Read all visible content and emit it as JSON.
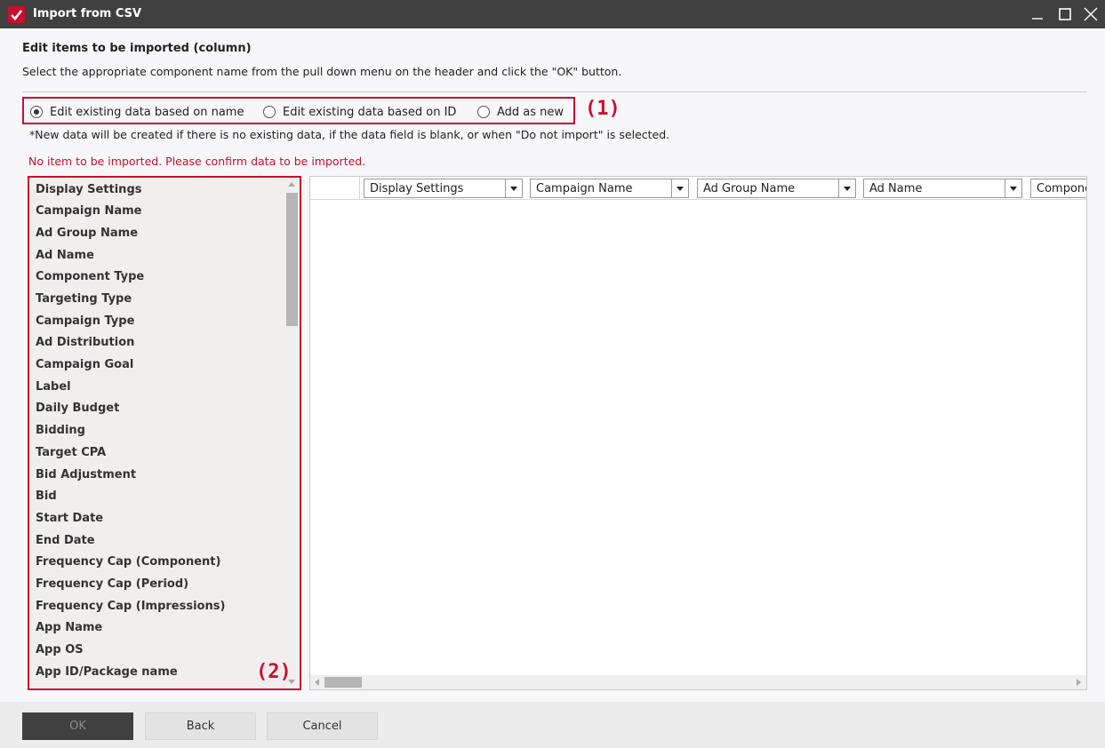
{
  "window": {
    "title": "Import from CSV"
  },
  "header": {
    "section_title": "Edit items to be imported (column)",
    "instruction": "Select the appropriate component name from the pull down menu on the header and click the \"OK\" button."
  },
  "import_mode": {
    "options": [
      {
        "label": "Edit existing data based on name",
        "selected": true
      },
      {
        "label": "Edit existing data based on ID",
        "selected": false
      },
      {
        "label": "Add as new",
        "selected": false
      }
    ],
    "annotation": "(1)"
  },
  "note": "*New data will be created if there is no existing data, if the data field is blank, or when \"Do not import\" is selected.",
  "error_message": "No item to be imported. Please confirm data to be imported.",
  "item_list": {
    "annotation": "(2)",
    "items": [
      "Display Settings",
      "Campaign Name",
      "Ad Group Name",
      "Ad Name",
      "Component Type",
      "Targeting Type",
      "Campaign Type",
      "Ad Distribution",
      "Campaign Goal",
      "Label",
      "Daily Budget",
      "Bidding",
      "Target CPA",
      "Bid Adjustment",
      "Bid",
      "Start Date",
      "End Date",
      "Frequency Cap (Component)",
      "Frequency Cap (Period)",
      "Frequency Cap (Impressions)",
      "App Name",
      "App OS",
      "App ID/Package name"
    ]
  },
  "grid": {
    "columns": [
      "Display Settings",
      "Campaign Name",
      "Ad Group Name",
      "Ad Name",
      "Component Type"
    ]
  },
  "footer": {
    "ok_label": "OK",
    "back_label": "Back",
    "cancel_label": "Cancel"
  }
}
